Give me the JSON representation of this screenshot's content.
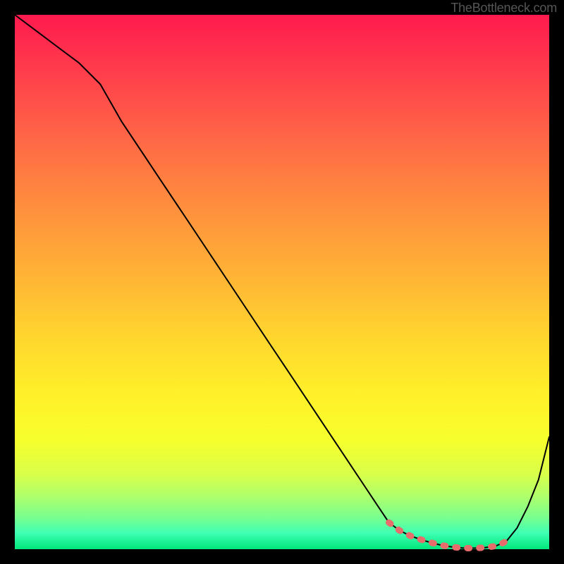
{
  "watermark": "TheBottleneck.com",
  "chart_data": {
    "type": "line",
    "title": "",
    "xlabel": "",
    "ylabel": "",
    "xlim": [
      0,
      100
    ],
    "ylim": [
      0,
      100
    ],
    "series": [
      {
        "name": "bottleneck-curve",
        "color": "#000000",
        "x": [
          0,
          4,
          8,
          12,
          16,
          20,
          24,
          28,
          32,
          36,
          40,
          44,
          48,
          52,
          56,
          60,
          64,
          68,
          70,
          72,
          74,
          76,
          78,
          80,
          82,
          84,
          86,
          88,
          90,
          92,
          94,
          96,
          98,
          100
        ],
        "values": [
          100,
          97,
          94,
          91,
          87,
          80,
          74,
          68,
          62,
          56,
          50,
          44,
          38,
          32,
          26,
          20,
          14,
          8,
          5,
          3.5,
          2.5,
          1.8,
          1.2,
          0.7,
          0.4,
          0.2,
          0.2,
          0.3,
          0.6,
          1.5,
          4,
          8,
          13,
          21
        ]
      }
    ],
    "markers": {
      "name": "dotted-segment",
      "color": "#e76c6c",
      "x": [
        70,
        72,
        74,
        76,
        78,
        80,
        82,
        84,
        86,
        88,
        89,
        90,
        91,
        92
      ],
      "values": [
        5,
        3.5,
        2.5,
        1.8,
        1.2,
        0.7,
        0.4,
        0.2,
        0.2,
        0.3,
        0.45,
        0.6,
        1.0,
        1.5
      ]
    },
    "gradient_desc": "vertical rainbow red-to-green"
  }
}
